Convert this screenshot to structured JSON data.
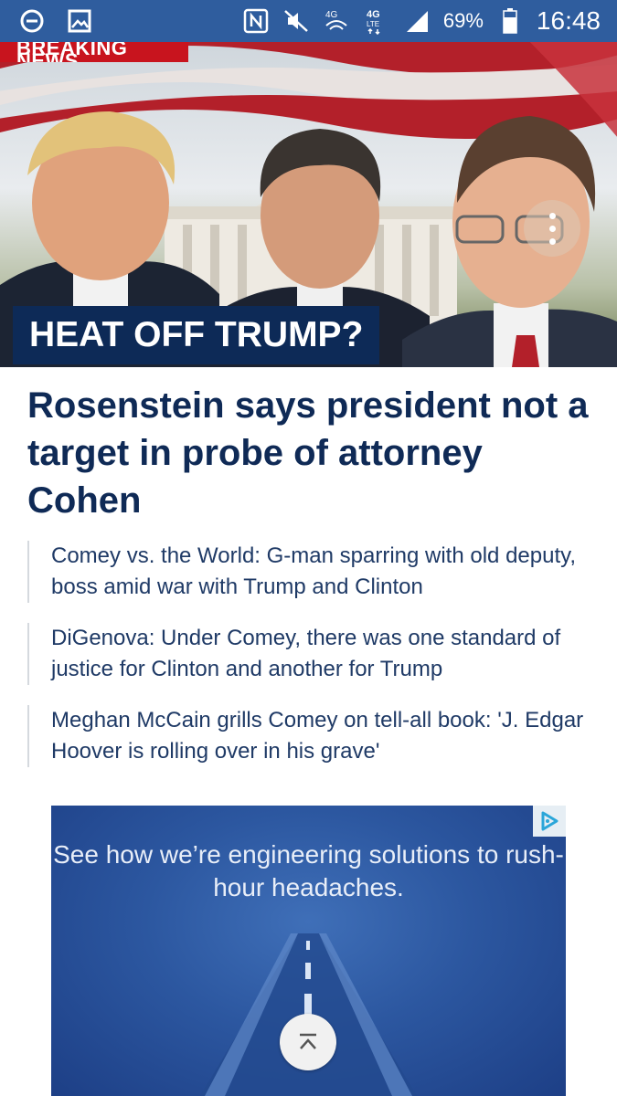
{
  "status_bar": {
    "battery": "69%",
    "time": "16:48",
    "icons": [
      "minus-circle-icon",
      "image-icon",
      "nfc-icon",
      "mute-icon",
      "wifi-4g-icon",
      "lte-icon",
      "signal-icon",
      "battery-icon"
    ],
    "color": "#2f5d9e"
  },
  "hero": {
    "breaking_label": "BREAKING NEWS",
    "caption": "HEAT OFF TRUMP?",
    "caption_bg": "#0d2a57"
  },
  "article": {
    "headline": "Rosenstein says president not a target in probe of attorney Cohen",
    "related": [
      "Comey vs. the World: G-man sparring with old deputy, boss amid war with Trump and Clinton",
      "DiGenova: Under Comey, there was one standard of justice for Clinton and another for Trump",
      "Meghan McCain grills Comey on tell-all book: 'J. Edgar Hoover is rolling over in his grave'"
    ],
    "headline_color": "#0f2a56"
  },
  "ad": {
    "text": "See how we’re engineering solutions to rush-hour headaches.",
    "badge_icon": "adchoices-icon"
  },
  "scroll_top_icon": "scroll-to-top-icon"
}
